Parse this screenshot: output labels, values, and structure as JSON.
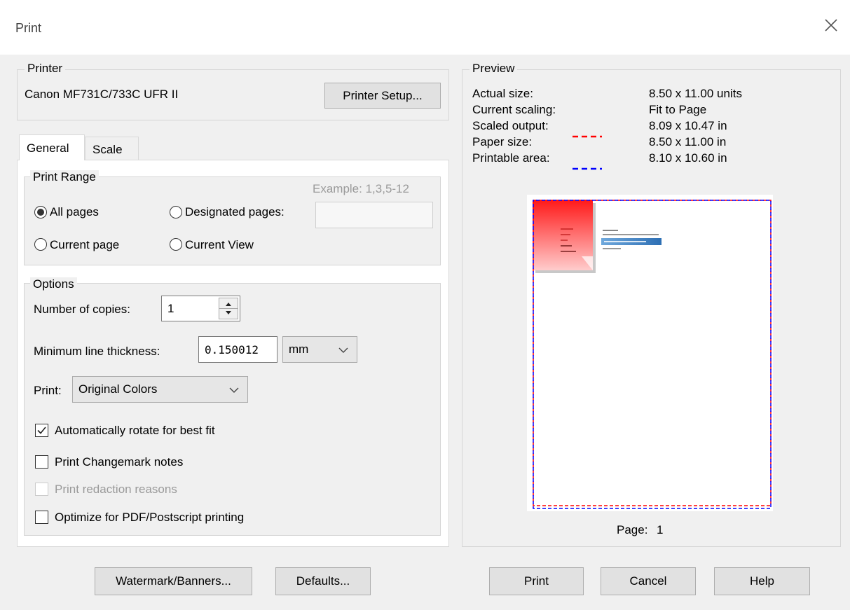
{
  "window": {
    "title": "Print"
  },
  "printer": {
    "group_label": "Printer",
    "name": "Canon MF731C/733C UFR II",
    "setup_button": "Printer Setup..."
  },
  "tabs": [
    {
      "label": "General",
      "active": true
    },
    {
      "label": "Scale",
      "active": false
    }
  ],
  "print_range": {
    "group_label": "Print Range",
    "example": "Example: 1,3,5-12",
    "all_pages": "All pages",
    "designated_pages": "Designated pages:",
    "designated_value": "",
    "current_page": "Current page",
    "current_view": "Current View",
    "selected": "All pages"
  },
  "options": {
    "group_label": "Options",
    "copies_label": "Number of copies:",
    "copies_value": "1",
    "thickness_label": "Minimum line thickness:",
    "thickness_value": "0.150012",
    "thickness_unit": "mm",
    "print_label": "Print:",
    "print_value": "Original Colors",
    "auto_rotate": {
      "label": "Automatically rotate for best fit",
      "checked": true
    },
    "changemark": {
      "label": "Print Changemark notes",
      "checked": false
    },
    "redaction": {
      "label": "Print redaction reasons",
      "checked": false,
      "disabled": true
    },
    "optimize": {
      "label": "Optimize for PDF/Postscript printing",
      "checked": false
    }
  },
  "preview": {
    "group_label": "Preview",
    "rows": [
      {
        "label": "Actual size:",
        "value": "8.50 x 11.00 units"
      },
      {
        "label": "Current scaling:",
        "value": "Fit to Page"
      },
      {
        "label": "Scaled output:",
        "value": "8.09 x 10.47 in"
      },
      {
        "label": "Paper size:",
        "value": "8.50 x 11.00 in"
      },
      {
        "label": "Printable area:",
        "value": "8.10 x 10.60 in"
      }
    ],
    "scaled_color": "#ff0000",
    "printable_color": "#0000ff",
    "page_label": "Page:",
    "page_number": "1"
  },
  "buttons": {
    "watermark": "Watermark/Banners...",
    "defaults": "Defaults...",
    "print": "Print",
    "cancel": "Cancel",
    "help": "Help"
  }
}
